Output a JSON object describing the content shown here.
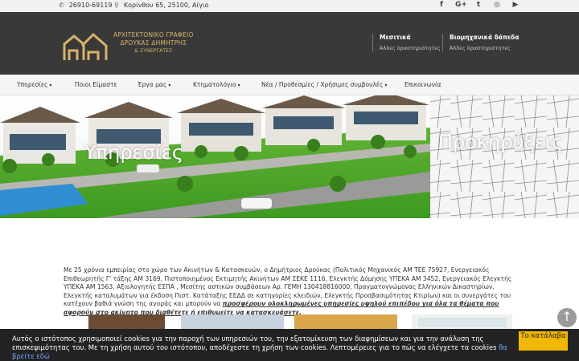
{
  "topbar": {
    "phone": "26910-69119",
    "address": "Κορίνθου 65, 25100, Αίγιο",
    "phone_icon": "phone-icon",
    "pin_icon": "map-pin-icon",
    "social": {
      "facebook": "f",
      "google": "G+",
      "twitter": "t",
      "instagram": "◎",
      "youtube": "▶"
    }
  },
  "header": {
    "logo_line1": "ΑΡΧΙΤΕΚΤΟΝΙΚΟ ΓΡΑΦΕΙΟ",
    "logo_line2": "ΔΡΟΥΚΑΣ ΔΗΜΗΤΡΗΣ",
    "logo_line3": "& ΣΥΝΕΡΓΑΤΕΣ",
    "links": [
      {
        "title": "Μεσιτικά",
        "subtitle": "Άλλες δραστηριότητες"
      },
      {
        "title": "Βιομηχανικά δάπεδα",
        "subtitle": "Άλλες δραστηριότητες"
      }
    ]
  },
  "nav": {
    "items": [
      {
        "label": "Υπηρεσίες",
        "caret": "▾"
      },
      {
        "label": "Ποιοι Είμαστε"
      },
      {
        "label": "Έργα μας",
        "caret": "▾"
      },
      {
        "label": "Κτηματολόγιο",
        "caret": "▾"
      },
      {
        "label": "Νέα / Προθεσμίες / Χρήσιμες συμβουλές",
        "caret": "▾"
      },
      {
        "label": "Επικοινωνία"
      }
    ]
  },
  "hero": {
    "slide1_title": "Υπηρεσίες",
    "slide2_title": "Προκηρύξεις"
  },
  "about": {
    "text": "Με 25 χρόνια εμπειρίας στο χώρο των Ακινήτων & Κατασκευών, ο Δημήτριος Δρούκας (Πολιτικός Μηχανικός ΑΜ ΤΕΕ 75927, Ενεργειακός Επιθεωρητής Γ' τάξης ΑΜ 3169, Πιστοποιημένος Εκτιμητής Ακινήτων ΑΜ ΣΕΚΕ 1116, Ελεγκτής Δόμησης ΥΠΕΚΑ ΑΜ 3452, Ενεργειακός Ελεγκτής ΥΠΕΚΑ ΑΜ 1563, Αξιολογητής ΕΣΠΑ , Μεσίτης αστικών συμβάσεων Αρ. ΓΕΜΗ 130418816000,  Πραγματογνώμονας Ελληνικών Δικαστηρίων, Ελεγκτής καταλυμάτων για έκδοση Πιστ. Κατάταξης ΕΕΔΔ σε κατηγορίες κλειδιών, Ελεγκτής Προσβασιμότητας Κτιρίων) και οι συνεργάτες του κατέχουν βαθιά γνώση της αγοράς και μπορούν να ",
    "emphasis": "προσφέρουν ολοκληρωμένες υπηρεσίες υψηλού επιπέδου για όλα τα θέματα που αφορούν στο ακίνητο που διαθέτετε ή επιθυμείτε να κατασκευάσετε."
  },
  "scroll_top_icon": "arrow-up-icon",
  "scroll_top_glyph": "↑",
  "cookie": {
    "text": "Αυτός ο ιστότοπος χρησιμοποιεί cookies για την παροχή των υπηρεσιών του, την εξατομίκευση των διαφημίσεων και για την ανάλυση της επισκεψιμότητας του. Με τη χρήση αυτού του ιστότοπου, αποδέχεστε τη χρήση των cookies. Λεπτομέρειες για το πώς να ελέγχετε τα cookies ",
    "link": "θα βρείτε εδώ",
    "button": "Το κατάλαβα"
  }
}
